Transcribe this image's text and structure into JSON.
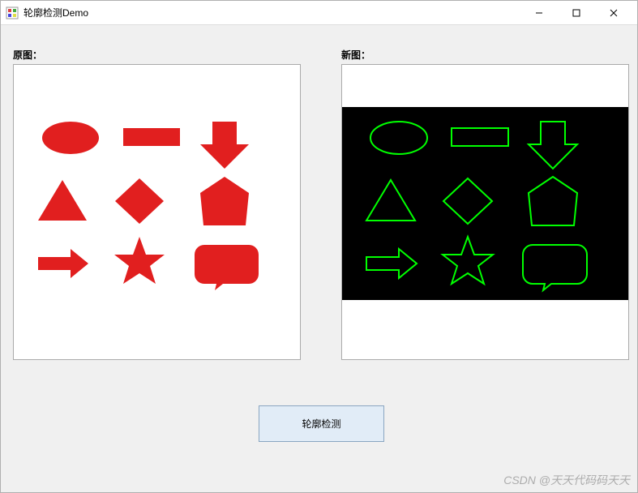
{
  "window": {
    "title": "轮廓检测Demo"
  },
  "labels": {
    "original": "原图：",
    "new": "新图："
  },
  "button": {
    "detect": "轮廓检测"
  },
  "watermark": "CSDN @天天代码码天天",
  "shapes": {
    "original": {
      "fill": "#e11f1f",
      "stroke": "none",
      "background": "#ffffff"
    },
    "new": {
      "fill": "none",
      "stroke": "#00ff00",
      "background": "#000000"
    },
    "items": [
      "ellipse",
      "rectangle",
      "down-arrow",
      "triangle",
      "diamond",
      "pentagon",
      "right-arrow",
      "star",
      "speech-bubble"
    ]
  }
}
